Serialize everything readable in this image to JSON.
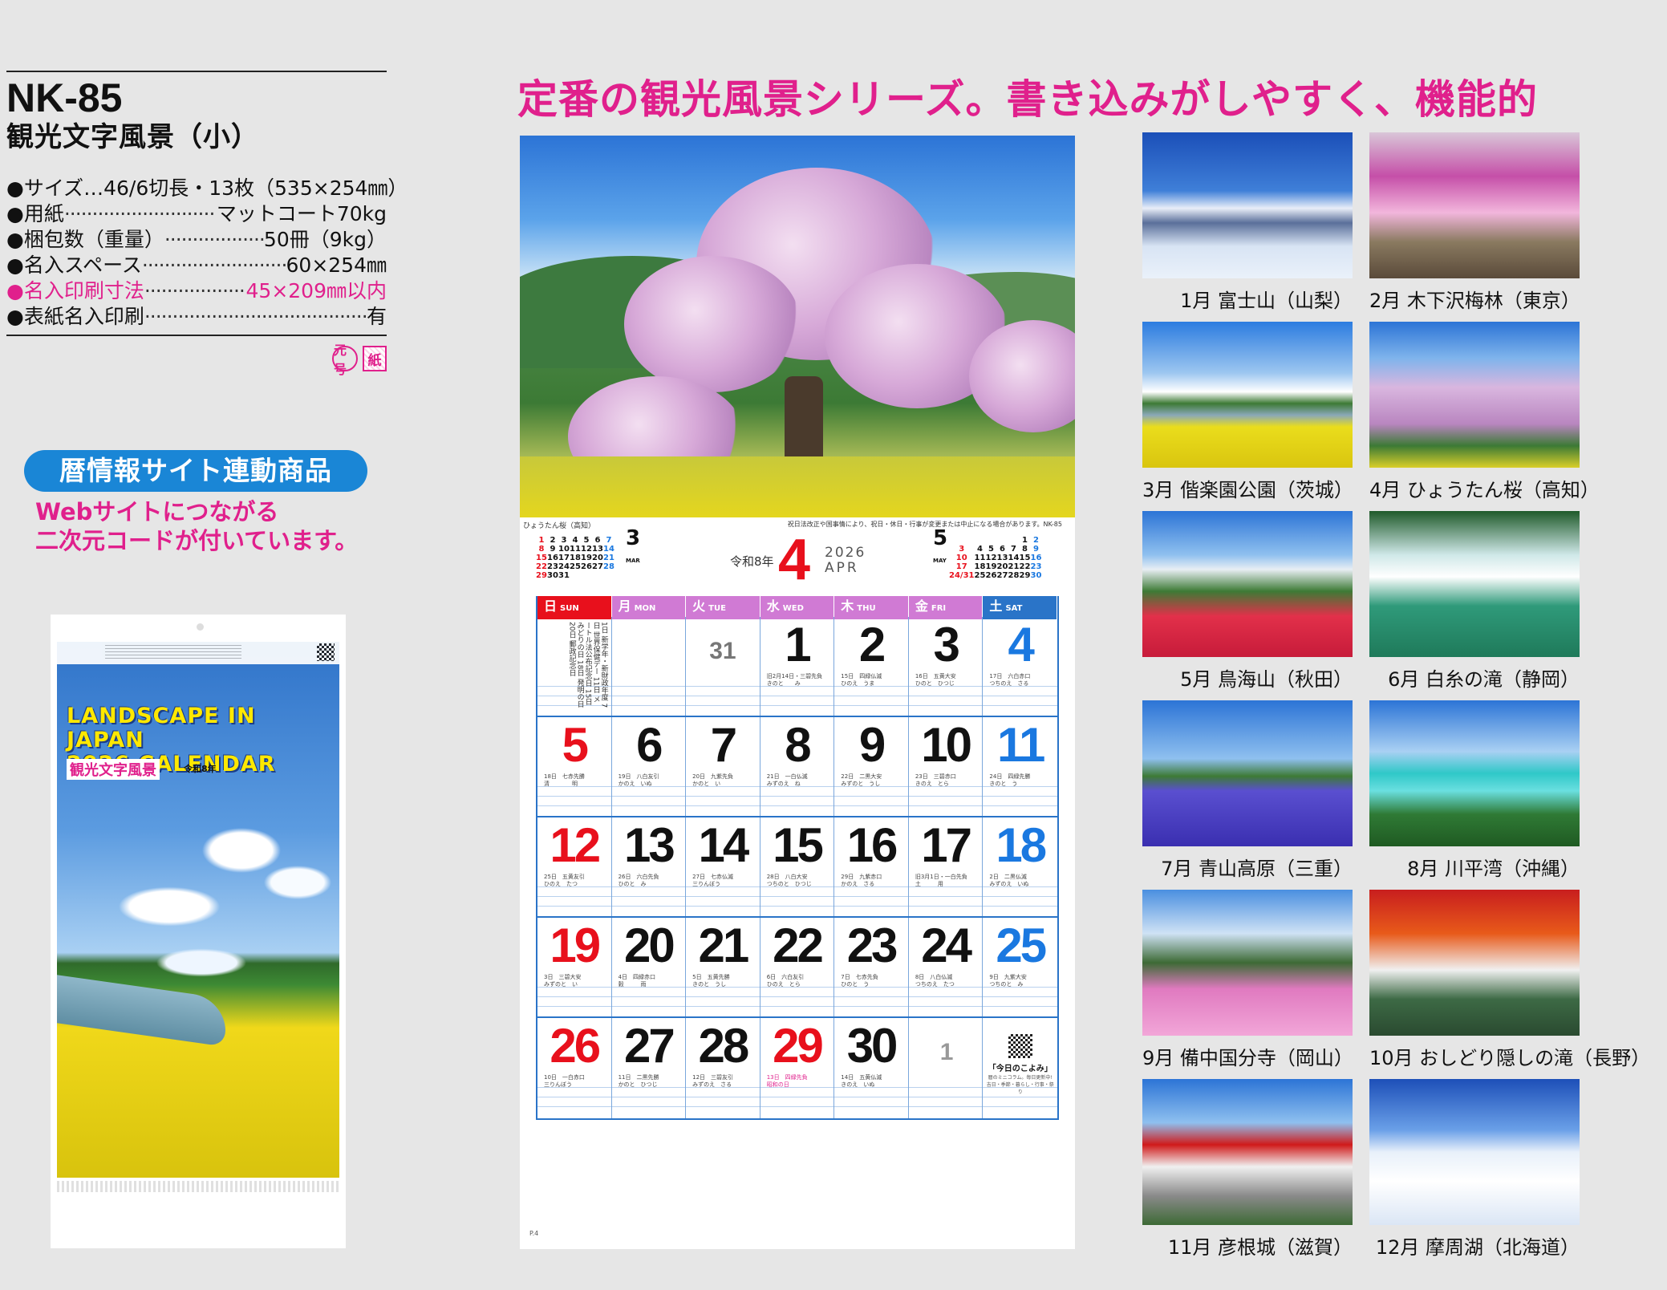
{
  "spec": {
    "model": "NK-85",
    "name": "観光文字風景（小）",
    "items": [
      {
        "label": "●サイズ",
        "value": "…46/6切長・13枚（535×254㎜）",
        "plain": true
      },
      {
        "label": "●用紙",
        "value": "マットコート70kg"
      },
      {
        "label": "●梱包数（重量）",
        "value": "50冊（9kg）"
      },
      {
        "label": "●名入スペース",
        "value": "60×254㎜"
      },
      {
        "label": "●名入印刷寸法",
        "value": "45×209㎜以内",
        "highlight": true
      },
      {
        "label": "●表紙名入印刷",
        "value": "有"
      }
    ],
    "marks": [
      "元号",
      "紙"
    ]
  },
  "linked": {
    "badge": "暦情報サイト連動商品",
    "desc": "Webサイトにつながる\n二次元コードが付いています。"
  },
  "cover": {
    "title_line1": "LANDSCAPE IN JAPAN",
    "title_line2": "2026 CALENDAR",
    "subtitle": "観光文字風景",
    "era": "令和8年"
  },
  "headline": "定番の観光風景シリーズ。書き込みがしやすく、機能的",
  "calendar": {
    "photo_caption": "ひょうたん桜（高知）",
    "photo_note": "祝日法改正や国事情により、祝日・休日・行事が変更または中止になる場合があります。NK-85",
    "era": "令和8年",
    "month": "4",
    "year": "2026",
    "month_en": "APR",
    "page_no": "P.4",
    "mini_prev": {
      "month": "3",
      "en": "MAR",
      "rows": [
        [
          "1",
          "2",
          "3",
          "4",
          "5",
          "6",
          "7"
        ],
        [
          "8",
          "9",
          "10",
          "11",
          "12",
          "13",
          "14"
        ],
        [
          "15",
          "16",
          "17",
          "18",
          "19",
          "20",
          "21"
        ],
        [
          "22",
          "23",
          "24",
          "25",
          "26",
          "27",
          "28"
        ],
        [
          "29",
          "30",
          "31",
          "",
          "",
          "",
          ""
        ]
      ]
    },
    "mini_next": {
      "month": "5",
      "en": "MAY",
      "rows": [
        [
          "",
          "",
          "",
          "",
          "",
          "1",
          "2"
        ],
        [
          "3",
          "4",
          "5",
          "6",
          "7",
          "8",
          "9"
        ],
        [
          "10",
          "11",
          "12",
          "13",
          "14",
          "15",
          "16"
        ],
        [
          "17",
          "18",
          "19",
          "20",
          "21",
          "22",
          "23"
        ],
        [
          "24/31",
          "25",
          "26",
          "27",
          "28",
          "29",
          "30"
        ]
      ]
    },
    "headers": [
      {
        "jp": "日",
        "en": "SUN"
      },
      {
        "jp": "月",
        "en": "MON"
      },
      {
        "jp": "火",
        "en": "TUE"
      },
      {
        "jp": "水",
        "en": "WED"
      },
      {
        "jp": "木",
        "en": "THU"
      },
      {
        "jp": "金",
        "en": "FRI"
      },
      {
        "jp": "土",
        "en": "SAT"
      }
    ],
    "holidays_note": "1日 新学年・新財政年度\n7日 世界保健デー\n11日 メートル法公布記念日\n15日 みどりの日\n18日 発明の日\n20日 郵政記念日",
    "weeks": [
      [
        "",
        "",
        "31",
        "1",
        "2",
        "3",
        "4"
      ],
      [
        "5",
        "6",
        "7",
        "8",
        "9",
        "10",
        "11"
      ],
      [
        "12",
        "13",
        "14",
        "15",
        "16",
        "17",
        "18"
      ],
      [
        "19",
        "20",
        "21",
        "22",
        "23",
        "24",
        "25"
      ],
      [
        "26",
        "27",
        "28",
        "29",
        "30",
        "1",
        ""
      ]
    ],
    "lunar": [
      [
        "",
        "",
        "",
        "旧2月14日・三碧先負\nきのと　　み",
        "15日　四緑仏滅\nひのえ　うま",
        "16日　五黄大安\nひのと　ひつじ",
        "17日　六白赤口\nつちのえ　さる"
      ],
      [
        "18日　七赤先勝\n清　　　　明",
        "19日　八白友引\nかのえ　いぬ",
        "20日　九紫先負\nかのと　い",
        "21日　一白仏滅\nみずのえ　ね",
        "22日　二黒大安\nみずのと　うし",
        "23日　三碧赤口\nきのえ　とら",
        "24日　四緑先勝\nきのと　う"
      ],
      [
        "25日　五黄友引\nひのえ　たつ",
        "26日　六白先負\nひのと　み",
        "27日　七赤仏滅\n三りんぼう",
        "28日　八白大安\nつちのと　ひつじ",
        "29日　九紫赤口\nかのえ　さる",
        "旧3月1日・一白先負\n土　　　用",
        "2日　二黒仏滅\nみずのえ　いぬ"
      ],
      [
        "3日　三碧大安\nみずのと　い",
        "4日　四緑赤口\n穀　　　雨",
        "5日　五黄先勝\nきのと　うし",
        "6日　六白友引\nひのえ　とら",
        "7日　七赤先負\nひのと　う",
        "8日　八白仏滅\nつちのえ　たつ",
        "9日　九紫大安\nつちのと　み"
      ],
      [
        "10日　一白赤口\n三りんぼう",
        "11日　二黒先勝\nかのと　ひつじ",
        "12日　三碧友引\nみずのえ　さる",
        "13日　四緑先負\n昭和の日",
        "14日　五黄仏滅\nきのえ　いぬ",
        "",
        ""
      ]
    ],
    "koyomi_title": "「今日のこよみ」",
    "koyomi_desc": "暦のミニコラム。毎日更新中!\n吉日・季節・暮らし・行事・祭り"
  },
  "months": [
    {
      "label": "1月 富士山（山梨）"
    },
    {
      "label": "2月 木下沢梅林（東京）"
    },
    {
      "label": "3月 偕楽園公園（茨城）"
    },
    {
      "label": "4月 ひょうたん桜（高知）"
    },
    {
      "label": "5月 鳥海山（秋田）"
    },
    {
      "label": "6月 白糸の滝（静岡）"
    },
    {
      "label": "7月 青山高原（三重）"
    },
    {
      "label": "8月 川平湾（沖縄）"
    },
    {
      "label": "9月 備中国分寺（岡山）"
    },
    {
      "label": "10月 おしどり隠しの滝（長野）"
    },
    {
      "label": "11月 彦根城（滋賀）"
    },
    {
      "label": "12月 摩周湖（北海道）"
    }
  ],
  "colors": {
    "accent": "#e0208c",
    "sunday": "#e8101c",
    "saturday": "#1a78e0",
    "weekday_header": "#d07ad4",
    "badge": "#1a86d6"
  }
}
